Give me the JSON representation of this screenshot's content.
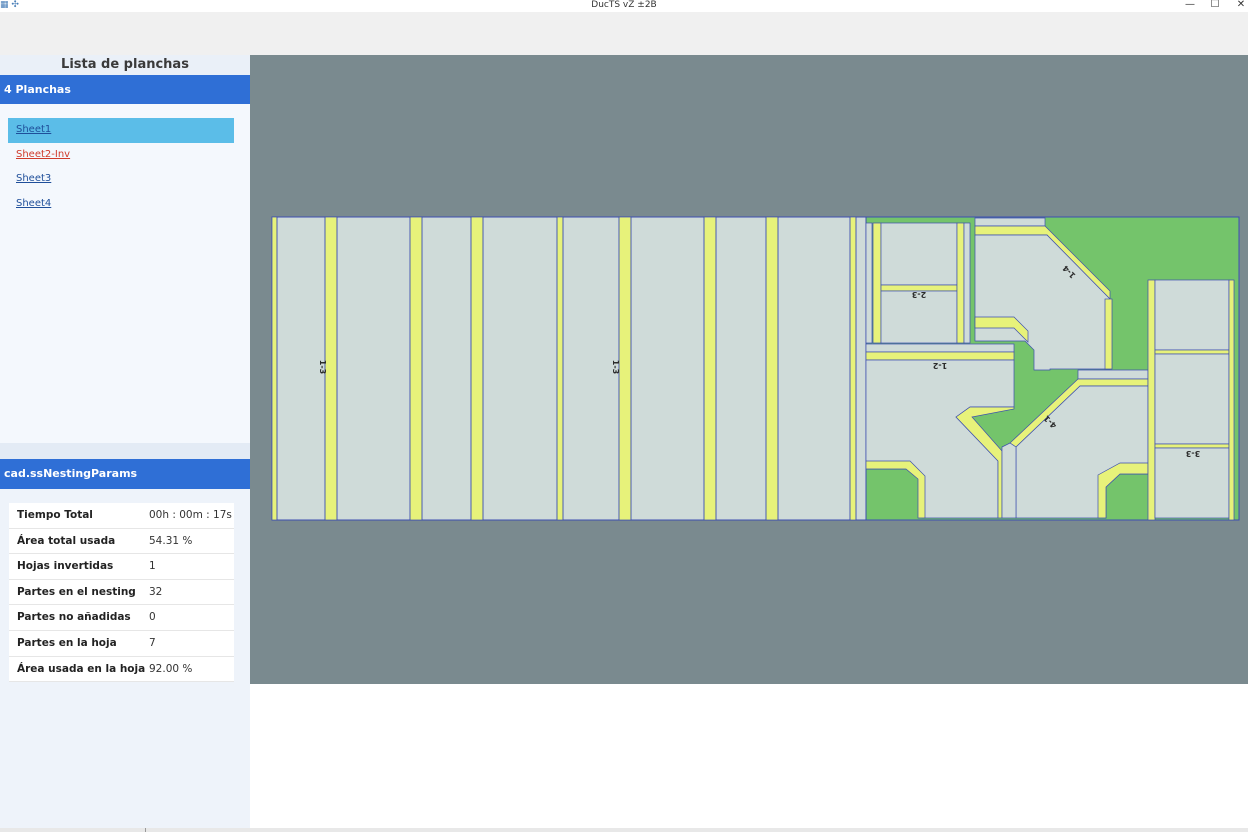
{
  "window": {
    "title": "DucTS vZ ±2B",
    "icons_left": "▦ ✣",
    "minimize_icon": "—",
    "maximize_icon": "☐",
    "close_icon": "✕"
  },
  "sheets_panel": {
    "heading": "Lista de planchas",
    "group_label": "4 Planchas",
    "items": [
      {
        "label": "Sheet1",
        "state": "selected"
      },
      {
        "label": "Sheet2-Inv",
        "state": "inverted"
      },
      {
        "label": "Sheet3",
        "state": "normal"
      },
      {
        "label": "Sheet4",
        "state": "normal"
      }
    ]
  },
  "params_panel": {
    "header": "cad.ssNestingParams",
    "rows": [
      {
        "label": "Tiempo Total",
        "value": "00h : 00m : 17s"
      },
      {
        "label": "Área total usada",
        "value": "54.31 %"
      },
      {
        "label": "Hojas invertidas",
        "value": "1"
      },
      {
        "label": "Partes en el nesting",
        "value": "32"
      },
      {
        "label": "Partes no añadidas",
        "value": "0"
      },
      {
        "label": "Partes en la hoja",
        "value": "7"
      },
      {
        "label": "Área usada en la hoja",
        "value": "92.00 %"
      }
    ]
  },
  "nesting_view": {
    "part_labels": [
      "1-3",
      "1-3",
      "2-3",
      "1-4",
      "1-2",
      "4-1",
      "3-3"
    ],
    "colors": {
      "canvas_bg": "#7a8a8f",
      "sheet_bg": "#74c46b",
      "part_fill": "#cfdbd9",
      "flange_fill": "#e7f27a",
      "outline": "#3d4fb0"
    }
  }
}
